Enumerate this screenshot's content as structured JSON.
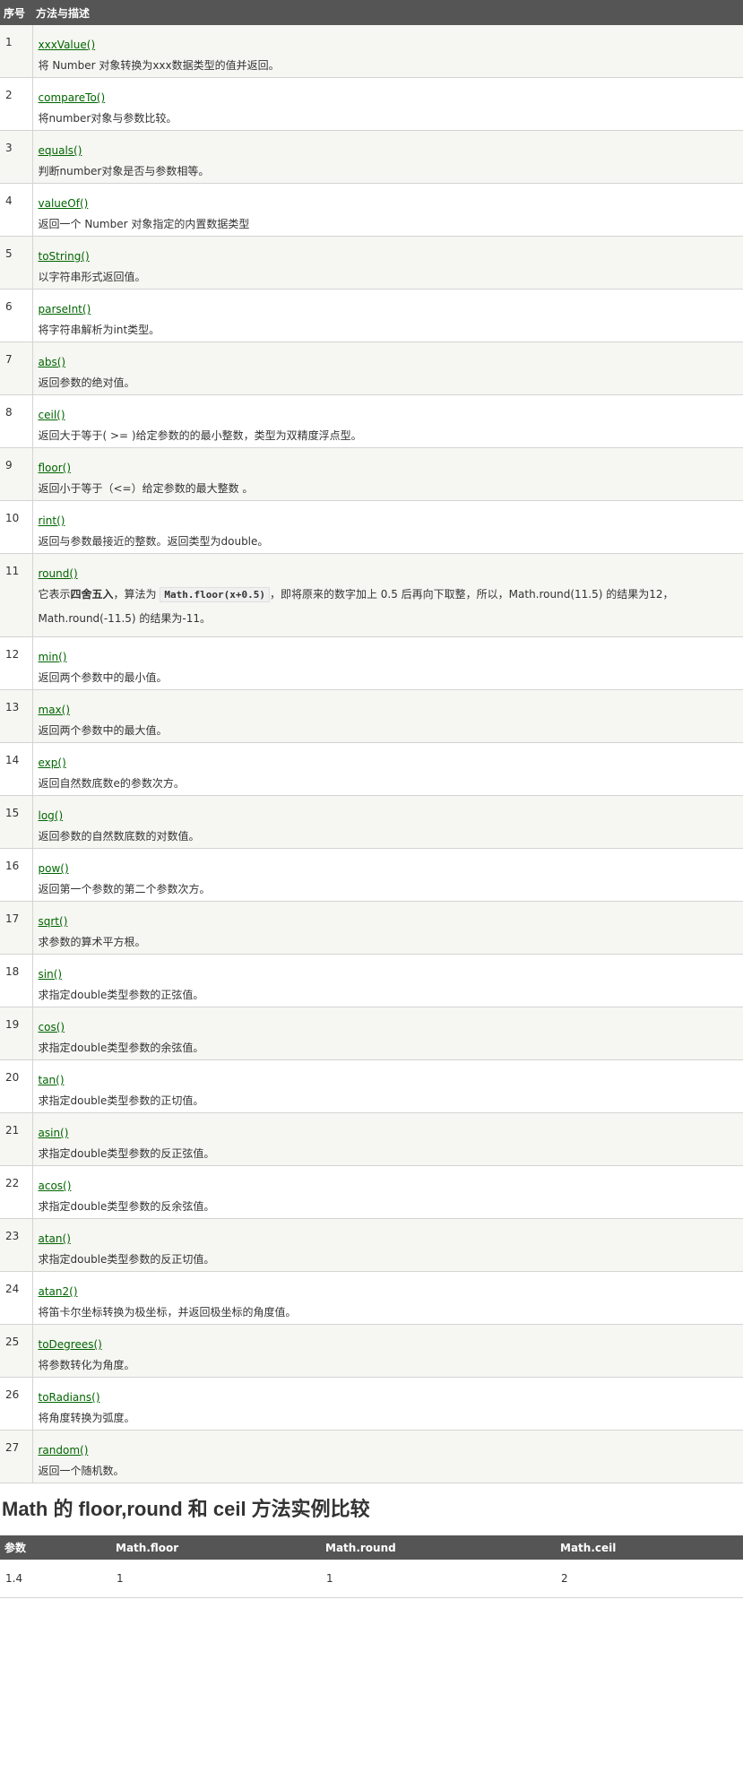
{
  "methods_table": {
    "headers": [
      "序号",
      "方法与描述"
    ],
    "rows": [
      {
        "num": "1",
        "name": "xxxValue()",
        "desc": "将 Number 对象转换为xxx数据类型的值并返回。"
      },
      {
        "num": "2",
        "name": "compareTo()",
        "desc": "将number对象与参数比较。"
      },
      {
        "num": "3",
        "name": "equals()",
        "desc": "判断number对象是否与参数相等。"
      },
      {
        "num": "4",
        "name": "valueOf()",
        "desc": "返回一个 Number 对象指定的内置数据类型"
      },
      {
        "num": "5",
        "name": "toString()",
        "desc": "以字符串形式返回值。"
      },
      {
        "num": "6",
        "name": "parseInt()",
        "desc": "将字符串解析为int类型。"
      },
      {
        "num": "7",
        "name": "abs()",
        "desc": "返回参数的绝对值。"
      },
      {
        "num": "8",
        "name": "ceil()",
        "desc": "返回大于等于( >= )给定参数的的最小整数，类型为双精度浮点型。"
      },
      {
        "num": "9",
        "name": "floor()",
        "desc": "返回小于等于（<=）给定参数的最大整数 。"
      },
      {
        "num": "10",
        "name": "rint()",
        "desc": "返回与参数最接近的整数。返回类型为double。"
      },
      {
        "num": "11",
        "name": "round()",
        "desc_pre": "它表示",
        "desc_bold": "四舍五入",
        "desc_mid": "，算法为 ",
        "desc_code": "Math.floor(x+0.5)",
        "desc_post": "，即将原来的数字加上 0.5 后再向下取整，所以，Math.round(11.5) 的结果为12，Math.round(-11.5) 的结果为-11。"
      },
      {
        "num": "12",
        "name": "min()",
        "desc": "返回两个参数中的最小值。"
      },
      {
        "num": "13",
        "name": "max()",
        "desc": "返回两个参数中的最大值。"
      },
      {
        "num": "14",
        "name": "exp()",
        "desc": "返回自然数底数e的参数次方。"
      },
      {
        "num": "15",
        "name": "log()",
        "desc": "返回参数的自然数底数的对数值。"
      },
      {
        "num": "16",
        "name": "pow()",
        "desc": "返回第一个参数的第二个参数次方。"
      },
      {
        "num": "17",
        "name": "sqrt()",
        "desc": "求参数的算术平方根。"
      },
      {
        "num": "18",
        "name": "sin()",
        "desc": "求指定double类型参数的正弦值。"
      },
      {
        "num": "19",
        "name": "cos()",
        "desc": "求指定double类型参数的余弦值。"
      },
      {
        "num": "20",
        "name": "tan()",
        "desc": "求指定double类型参数的正切值。"
      },
      {
        "num": "21",
        "name": "asin()",
        "desc": "求指定double类型参数的反正弦值。"
      },
      {
        "num": "22",
        "name": "acos()",
        "desc": "求指定double类型参数的反余弦值。"
      },
      {
        "num": "23",
        "name": "atan()",
        "desc": "求指定double类型参数的反正切值。"
      },
      {
        "num": "24",
        "name": "atan2()",
        "desc": "将笛卡尔坐标转换为极坐标，并返回极坐标的角度值。"
      },
      {
        "num": "25",
        "name": "toDegrees()",
        "desc": "将参数转化为角度。"
      },
      {
        "num": "26",
        "name": "toRadians()",
        "desc": "将角度转换为弧度。"
      },
      {
        "num": "27",
        "name": "random()",
        "desc": "返回一个随机数。"
      }
    ]
  },
  "section_title": "Math 的 floor,round 和 ceil 方法实例比较",
  "compare_table": {
    "headers": [
      "参数",
      "Math.floor",
      "Math.round",
      "Math.ceil"
    ],
    "rows": [
      [
        "1.4",
        "1",
        "1",
        "2"
      ]
    ]
  },
  "colors": {
    "header_bg": "#555555",
    "link": "#006600",
    "stripe": "#f6f6f2"
  }
}
